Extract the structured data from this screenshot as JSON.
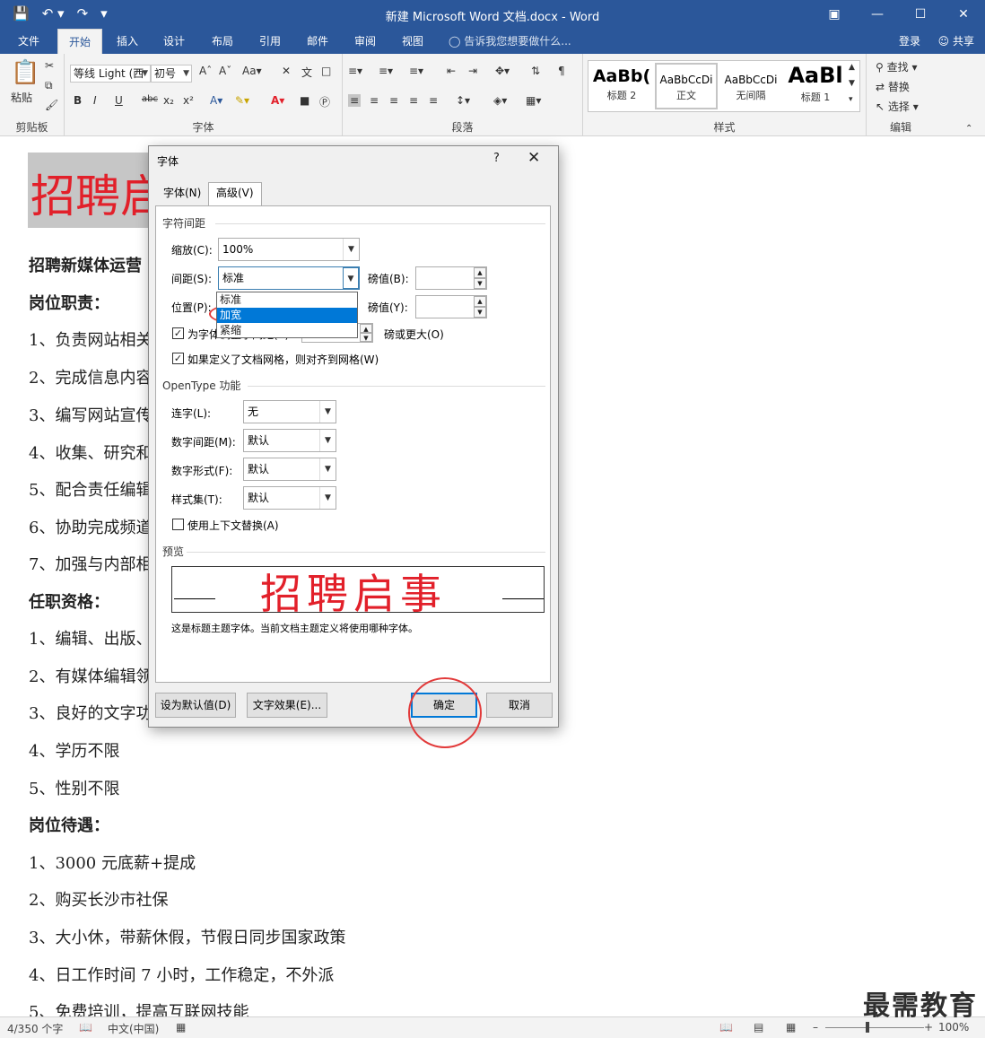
{
  "window": {
    "title": "新建 Microsoft Word 文档.docx - Word",
    "qat": {
      "save_icon": "save-icon",
      "undo_icon": "undo-icon",
      "redo_icon": "redo-icon"
    },
    "controls": [
      "ribbon-display-icon",
      "minimize-icon",
      "maximize-icon",
      "close-icon"
    ]
  },
  "ribbon_tabs": [
    "文件",
    "开始",
    "插入",
    "设计",
    "布局",
    "引用",
    "邮件",
    "审阅",
    "视图"
  ],
  "tell_me": "告诉我您想要做什么...",
  "account": {
    "login": "登录",
    "share": "共享"
  },
  "ribbon": {
    "clipboard": {
      "paste": "粘贴",
      "group": "剪贴板"
    },
    "font": {
      "font_name": "等线 Light (西",
      "font_size": "初号",
      "group": "字体",
      "bold": "B",
      "italic": "I",
      "underline": "U",
      "strike": "abc",
      "sub": "x₂",
      "sup": "x²"
    },
    "paragraph": {
      "group": "段落"
    },
    "styles": {
      "group": "样式",
      "items": [
        {
          "sample": "AaBb(",
          "name": "标题 2"
        },
        {
          "sample": "AaBbCcDi",
          "name": "正文"
        },
        {
          "sample": "AaBbCcDi",
          "name": "无间隔"
        },
        {
          "sample": "AaBl",
          "name": "标题 1"
        }
      ]
    },
    "editing": {
      "group": "编辑",
      "find": "查找",
      "replace": "替换",
      "select": "选择"
    }
  },
  "document": {
    "heading": "招聘启",
    "lines": [
      {
        "text": "招聘新媒体运营",
        "bold": true
      },
      {
        "text": "岗位职责：",
        "bold": true
      },
      {
        "text": "1、负责网站相关",
        "bold": false
      },
      {
        "text": "2、完成信息内容",
        "bold": false
      },
      {
        "text": "3、编写网站宣传",
        "bold": false
      },
      {
        "text": "4、收集、研究和",
        "bold": false
      },
      {
        "text": "5、配合责任编辑",
        "bold": false
      },
      {
        "text": "6、协助完成频道",
        "bold": false
      },
      {
        "text": "7、加强与内部相",
        "bold": false
      },
      {
        "text": "任职资格：",
        "bold": true
      },
      {
        "text": "1、编辑、出版、",
        "bold": false
      },
      {
        "text": "2、有媒体编辑领",
        "bold": false
      },
      {
        "text": "3、良好的文字功",
        "bold": false
      },
      {
        "text": "4、学历不限",
        "bold": false
      },
      {
        "text": "5、性别不限",
        "bold": false
      },
      {
        "text": "岗位待遇：",
        "bold": true
      },
      {
        "text": "1、3000 元底薪+提成",
        "bold": false
      },
      {
        "text": "2、购买长沙市社保",
        "bold": false
      },
      {
        "text": "3、大小休，带薪休假，节假日同步国家政策",
        "bold": false
      },
      {
        "text": "4、日工作时间 7 小时，工作稳定，不外派",
        "bold": false
      },
      {
        "text": "5、免费培训，提高互联网技能",
        "bold": false
      }
    ]
  },
  "dialog": {
    "title": "字体",
    "help": "?",
    "tabs": [
      "字体(N)",
      "高级(V)"
    ],
    "spacing_section": "字符间距",
    "scale_label": "缩放(C):",
    "scale_value": "100%",
    "spacing_label": "间距(S):",
    "spacing_value": "标准",
    "pos_label": "位置(P):",
    "pt1_label": "磅值(B):",
    "pt2_label": "磅值(Y):",
    "kerning_label": "为字体调整字间距(K):",
    "kerning_suffix": "磅或更大(O)",
    "grid_label": "如果定义了文档网格，则对齐到网格(W)",
    "spacing_options": [
      "标准",
      "加宽",
      "紧缩"
    ],
    "spacing_highlight": 1,
    "opentype_section": "OpenType 功能",
    "ligature_label": "连字(L):",
    "ligature_value": "无",
    "numspacing_label": "数字间距(M):",
    "numspacing_value": "默认",
    "numform_label": "数字形式(F):",
    "numform_value": "默认",
    "styleset_label": "样式集(T):",
    "styleset_value": "默认",
    "contextual_label": "使用上下文替换(A)",
    "preview_section": "预览",
    "preview_text": "招聘启事",
    "preview_note": "这是标题主题字体。当前文档主题定义将使用哪种字体。",
    "set_default": "设为默认值(D)",
    "text_effects": "文字效果(E)...",
    "ok": "确定",
    "cancel": "取消"
  },
  "statusbar": {
    "words": "4/350 个字",
    "lang": "中文(中国)",
    "zoom": "100%"
  },
  "watermark": "最需教育",
  "colors": {
    "brand": "#2b579a",
    "accent_red": "#e2202a",
    "highlight": "#0078d7"
  }
}
